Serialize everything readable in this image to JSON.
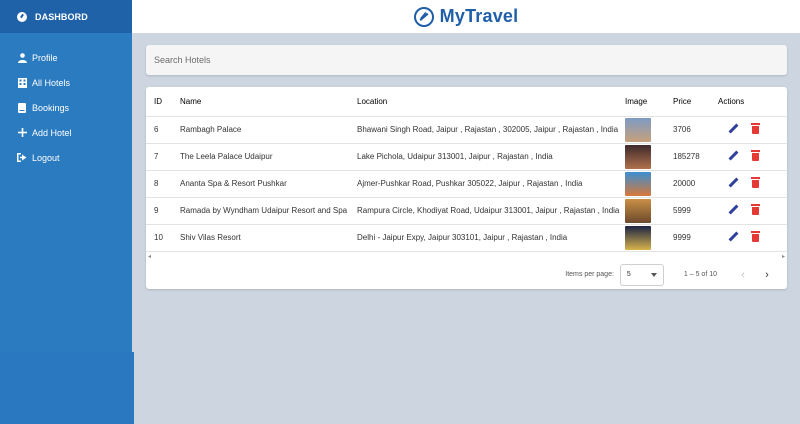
{
  "sidebar": {
    "title": "DASHBORD",
    "items": [
      {
        "label": "Profile",
        "icon": "person-icon"
      },
      {
        "label": "All Hotels",
        "icon": "building-icon"
      },
      {
        "label": "Bookings",
        "icon": "book-icon"
      },
      {
        "label": "Add Hotel",
        "icon": "plus-icon"
      },
      {
        "label": "Logout",
        "icon": "logout-icon"
      }
    ]
  },
  "header": {
    "brand": "MyTravel"
  },
  "search": {
    "placeholder": "Search Hotels"
  },
  "table": {
    "columns": [
      "ID",
      "Name",
      "Location",
      "Image",
      "Price",
      "Actions"
    ],
    "rows": [
      {
        "id": "6",
        "name": "Rambagh Palace",
        "location": "Bhawani Singh Road, Jaipur , Rajastan , 302005, Jaipur , Rajastan , India",
        "price": "3706",
        "image_colors": [
          "#7e9bc4",
          "#c7a07a"
        ]
      },
      {
        "id": "7",
        "name": "The Leela Palace Udaipur",
        "location": "Lake Pichola, Udaipur 313001, Jaipur , Rajastan , India",
        "price": "185278",
        "image_colors": [
          "#3d2a2c",
          "#b0724c"
        ]
      },
      {
        "id": "8",
        "name": "Ananta Spa & Resort Pushkar",
        "location": "Ajmer-Pushkar Road, Pushkar 305022, Jaipur , Rajastan , India",
        "price": "20000",
        "image_colors": [
          "#3b8fd1",
          "#d8783a"
        ]
      },
      {
        "id": "9",
        "name": "Ramada by Wyndham Udaipur Resort and Spa",
        "location": "Rampura Circle, Khodiyat Road, Udaipur 313001, Jaipur , Rajastan , India",
        "price": "5999",
        "image_colors": [
          "#c98f45",
          "#6c4a2d"
        ]
      },
      {
        "id": "10",
        "name": "Shiv Vilas Resort",
        "location": "Delhi - Jaipur Expy, Jaipur 303101, Jaipur , Rajastan , India",
        "price": "9999",
        "image_colors": [
          "#1b2444",
          "#d8b24a"
        ]
      }
    ]
  },
  "paginator": {
    "items_per_page_label": "Items per page:",
    "page_size": "5",
    "range": "1 – 5 of 10"
  },
  "colors": {
    "sidebar": "#2b7bc1",
    "sidebar_head": "#1f62a8",
    "brand": "#1f5fa8",
    "edit": "#2f3f9c",
    "delete": "#e53935"
  }
}
